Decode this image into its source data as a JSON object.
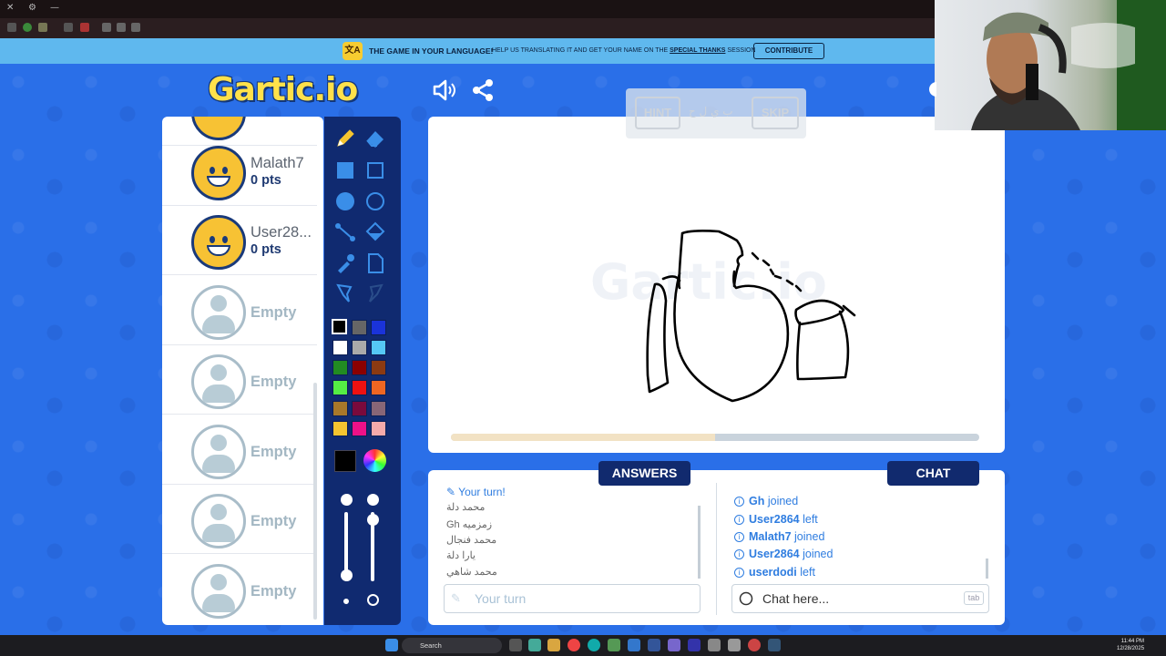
{
  "banner": {
    "headline": "THE GAME IN YOUR LANGUAGE!",
    "text_before": "HELP US TRANSLATING IT AND GET YOUR NAME ON THE ",
    "text_special": "SPECIAL THANKS",
    "text_after": " SESSION",
    "contribute_label": "CONTRIBUTE"
  },
  "logo": {
    "text": "Gartic.io"
  },
  "players": [
    {
      "name": "Malath7",
      "points": "0 pts",
      "avatar": "filled"
    },
    {
      "name": "User28...",
      "points": "0 pts",
      "avatar": "filled"
    },
    {
      "name": "Empty",
      "points": "",
      "avatar": "empty"
    },
    {
      "name": "Empty",
      "points": "",
      "avatar": "empty"
    },
    {
      "name": "Empty",
      "points": "",
      "avatar": "empty"
    },
    {
      "name": "Empty",
      "points": "",
      "avatar": "empty"
    },
    {
      "name": "Empty",
      "points": "",
      "avatar": "empty"
    }
  ],
  "tools": {
    "items": [
      "pencil-icon",
      "eraser-icon",
      "filled-rect-icon",
      "rect-icon",
      "filled-circle-icon",
      "circle-icon",
      "line-icon",
      "fill-icon",
      "eyedropper-icon",
      "page-icon",
      "brush-icon",
      "brush-disabled-icon"
    ],
    "colors": [
      "#000000",
      "#666666",
      "#1a33d9",
      "#ffffff",
      "#aaaaaa",
      "#55c8f5",
      "#228b22",
      "#8b0000",
      "#8b3a12",
      "#55ee44",
      "#ee1111",
      "#ee6622",
      "#a8782a",
      "#7a0a3c",
      "#886677",
      "#f5c530",
      "#ee1188",
      "#f5aaaa"
    ],
    "current_color": "#000000"
  },
  "hint": {
    "hint_label": "HINT",
    "word": "ب ي ل ح",
    "skip_label": "SKIP"
  },
  "canvas": {
    "watermark": "Gartic.io",
    "time_progress": 0.5
  },
  "answers": {
    "tab_label": "ANSWERS",
    "your_turn": "Your turn!",
    "items": [
      "محمد دلة",
      "Gh زمزميه",
      "محمد فنجال",
      "يارا دلة",
      "محمد شاهي"
    ],
    "input_placeholder": "Your turn"
  },
  "chat": {
    "tab_label": "CHAT",
    "items": [
      {
        "user": "Gh",
        "action": "joined"
      },
      {
        "user": "User2864",
        "action": "left"
      },
      {
        "user": "Malath7",
        "action": "joined"
      },
      {
        "user": "User2864",
        "action": "joined"
      },
      {
        "user": "userdodi",
        "action": "left"
      }
    ],
    "input_placeholder": "Chat here...",
    "tab_hint": "tab"
  },
  "taskbar": {
    "search_label": "Search",
    "time": "11:44 PM",
    "date": "12/28/2025"
  }
}
